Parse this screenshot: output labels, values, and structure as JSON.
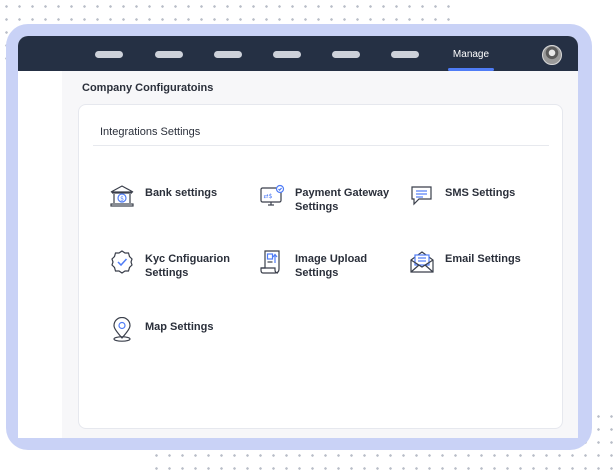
{
  "navbar": {
    "active_label": "Manage",
    "accent_color": "#4f7cf6",
    "background_color": "#253044"
  },
  "page": {
    "title": "Company Configuratoins"
  },
  "card": {
    "title": "Integrations Settings",
    "items": [
      {
        "label": "Bank settings",
        "icon": "bank-icon"
      },
      {
        "label": "Payment Gateway Settings",
        "icon": "payment-gateway-icon"
      },
      {
        "label": "SMS Settings",
        "icon": "sms-icon"
      },
      {
        "label": "Kyc Cnfiguarion Settings",
        "icon": "kyc-badge-icon"
      },
      {
        "label": "Image Upload Settings",
        "icon": "image-upload-icon"
      },
      {
        "label": "Email Settings",
        "icon": "email-icon"
      },
      {
        "label": "Map Settings",
        "icon": "map-pin-icon"
      }
    ]
  }
}
